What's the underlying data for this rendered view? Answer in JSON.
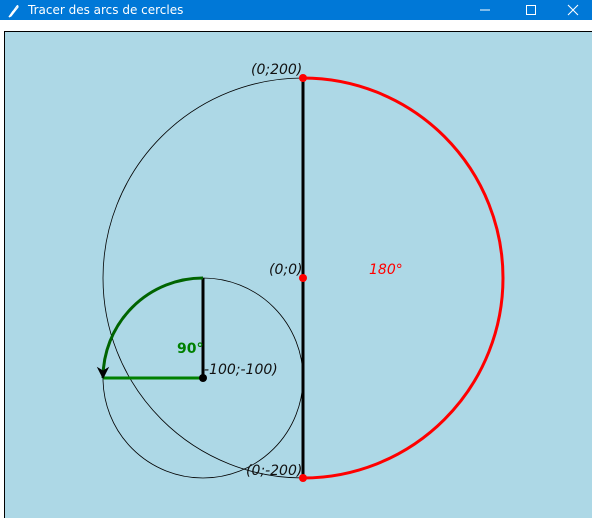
{
  "window": {
    "title": "Tracer des arcs de cercles",
    "app_icon": "feather-pen-icon",
    "controls": [
      "minimize-icon",
      "maximize-icon",
      "close-icon"
    ]
  },
  "canvas": {
    "background": "#add8e6",
    "points": [
      {
        "label": "(0;200)",
        "color": "#ff0000"
      },
      {
        "label": "(0;0)",
        "color": "#ff0000"
      },
      {
        "label": "(0;-200)",
        "color": "#ff0000"
      },
      {
        "label": "-100;-100)",
        "color": "#000000"
      }
    ],
    "arcs": [
      {
        "label": "180°",
        "color": "#ff0000"
      },
      {
        "label": "90°",
        "color": "#008000"
      }
    ]
  }
}
